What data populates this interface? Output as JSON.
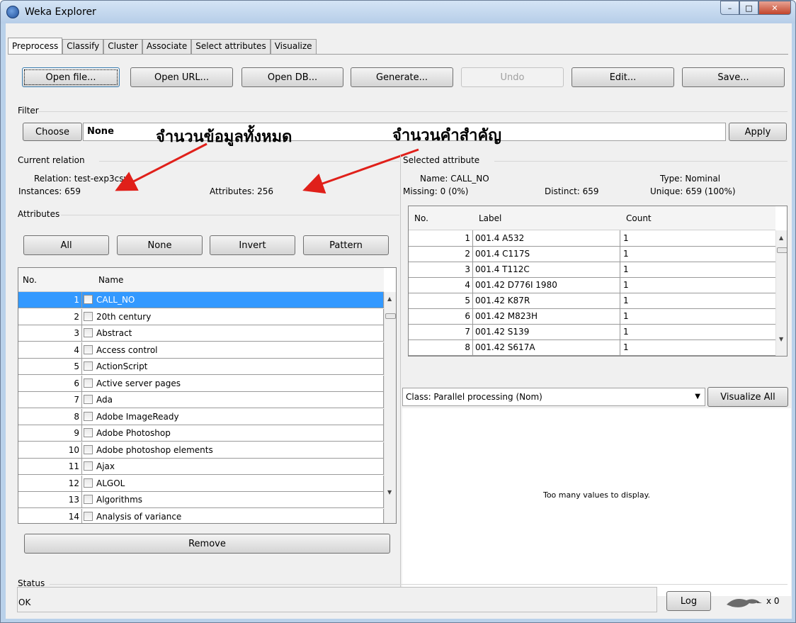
{
  "window": {
    "title": "Weka Explorer"
  },
  "tabs": [
    "Preprocess",
    "Classify",
    "Cluster",
    "Associate",
    "Select attributes",
    "Visualize"
  ],
  "toolbar": {
    "open_file": "Open file...",
    "open_url": "Open URL...",
    "open_db": "Open DB...",
    "generate": "Generate...",
    "undo": "Undo",
    "edit": "Edit...",
    "save": "Save..."
  },
  "filter": {
    "label": "Filter",
    "choose": "Choose",
    "value": "None",
    "apply": "Apply"
  },
  "annotations": {
    "total_data": "จำนวนข้อมูลทั้งหมด",
    "keyword_count": "จำนวนคำสำคัญ"
  },
  "current_relation": {
    "header": "Current relation",
    "relation": "Relation: test-exp3csv",
    "instances": "Instances: 659",
    "attributes": "Attributes: 256"
  },
  "attributes": {
    "header": "Attributes",
    "buttons": {
      "all": "All",
      "none": "None",
      "invert": "Invert",
      "pattern": "Pattern"
    },
    "columns": {
      "no": "No.",
      "name": "Name"
    },
    "rows": [
      {
        "no": "1",
        "name": "CALL_NO"
      },
      {
        "no": "2",
        "name": "20th century"
      },
      {
        "no": "3",
        "name": "Abstract"
      },
      {
        "no": "4",
        "name": "Access control"
      },
      {
        "no": "5",
        "name": "ActionScript"
      },
      {
        "no": "6",
        "name": "Active server pages"
      },
      {
        "no": "7",
        "name": "Ada"
      },
      {
        "no": "8",
        "name": "Adobe ImageReady"
      },
      {
        "no": "9",
        "name": "Adobe Photoshop"
      },
      {
        "no": "10",
        "name": "Adobe photoshop elements"
      },
      {
        "no": "11",
        "name": "Ajax"
      },
      {
        "no": "12",
        "name": "ALGOL"
      },
      {
        "no": "13",
        "name": "Algorithms"
      },
      {
        "no": "14",
        "name": "Analysis of variance"
      }
    ],
    "remove": "Remove"
  },
  "selected_attribute": {
    "header": "Selected attribute",
    "name": "Name: CALL_NO",
    "type": "Type: Nominal",
    "missing": "Missing: 0 (0%)",
    "distinct": "Distinct: 659",
    "unique": "Unique: 659 (100%)",
    "columns": {
      "no": "No.",
      "label": "Label",
      "count": "Count"
    },
    "rows": [
      {
        "no": "1",
        "label": "001.4 A532",
        "count": "1"
      },
      {
        "no": "2",
        "label": "001.4 C117S",
        "count": "1"
      },
      {
        "no": "3",
        "label": "001.4 T112C",
        "count": "1"
      },
      {
        "no": "4",
        "label": "001.42 D776I 1980",
        "count": "1"
      },
      {
        "no": "5",
        "label": "001.42 K87R",
        "count": "1"
      },
      {
        "no": "6",
        "label": "001.42 M823H",
        "count": "1"
      },
      {
        "no": "7",
        "label": "001.42 S139",
        "count": "1"
      },
      {
        "no": "8",
        "label": "001.42 S617A",
        "count": "1"
      }
    ]
  },
  "class_select": "Class: Parallel processing (Nom)",
  "visualize_all": "Visualize All",
  "visual_message": "Too many values to display.",
  "status": {
    "label": "Status",
    "text": "OK",
    "log": "Log",
    "count": "x 0"
  },
  "colors": {
    "selection": "#3399ff",
    "arrow": "#e0201a"
  }
}
